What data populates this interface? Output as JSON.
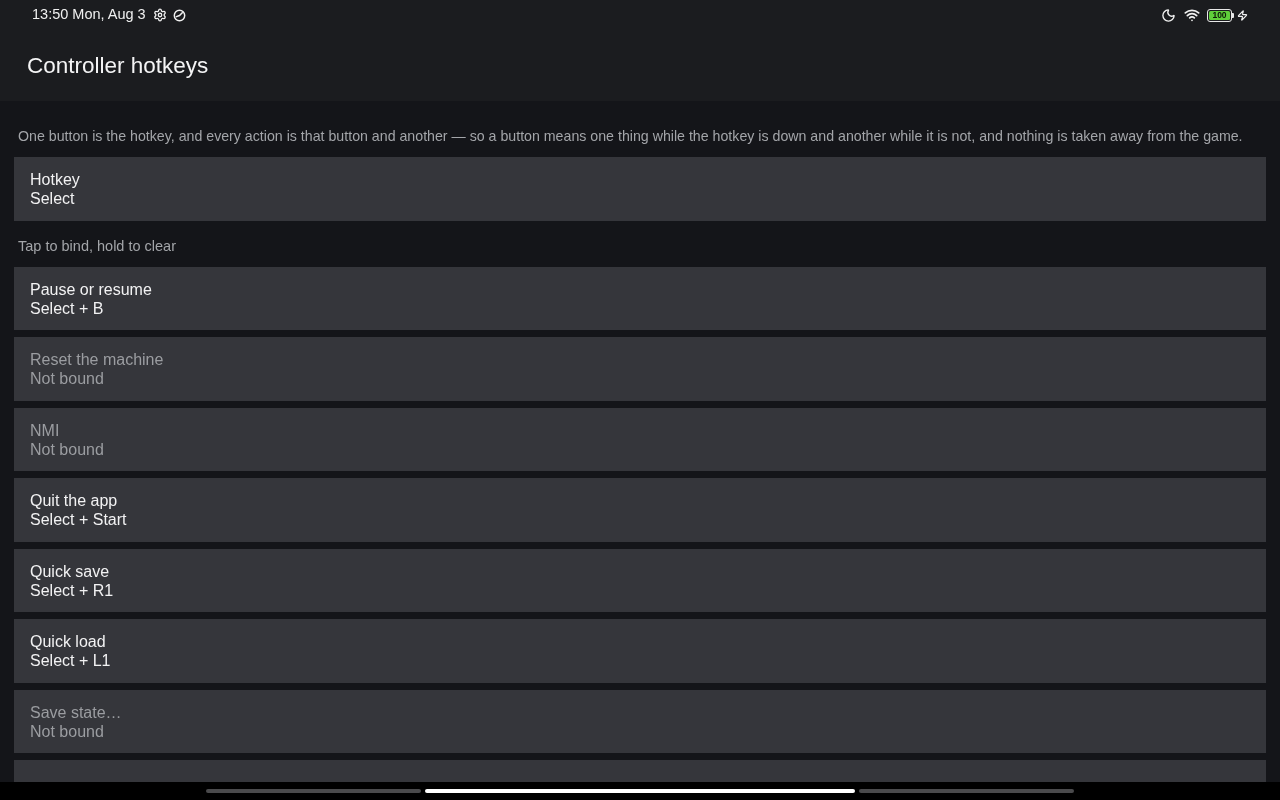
{
  "status_bar": {
    "time": "13:50 Mon, Aug 3",
    "battery": {
      "label": "100",
      "level": 1
    }
  },
  "toolbar": {
    "title": "Controller hotkeys"
  },
  "description": "One button is the hotkey, and every action is that button and another — so a button means one thing while the hotkey is down and another while it is not, and nothing is taken away from the game.",
  "hotkey": {
    "title": "Hotkey",
    "value": "Select"
  },
  "hint": "Tap to bind, hold to clear",
  "actions": [
    {
      "title": "Pause or resume",
      "binding": "Select + B",
      "disabled": false
    },
    {
      "title": "Reset the machine",
      "binding": "Not bound",
      "disabled": true
    },
    {
      "title": "NMI",
      "binding": "Not bound",
      "disabled": true
    },
    {
      "title": "Quit the app",
      "binding": "Select + Start",
      "disabled": false
    },
    {
      "title": "Quick save",
      "binding": "Select + R1",
      "disabled": false
    },
    {
      "title": "Quick load",
      "binding": "Select + L1",
      "disabled": false
    },
    {
      "title": "Save state…",
      "binding": "Not bound",
      "disabled": true
    }
  ],
  "gesture_bar": {
    "segments": [
      {
        "selected": false
      },
      {
        "selected": true
      },
      {
        "selected": false
      }
    ]
  }
}
